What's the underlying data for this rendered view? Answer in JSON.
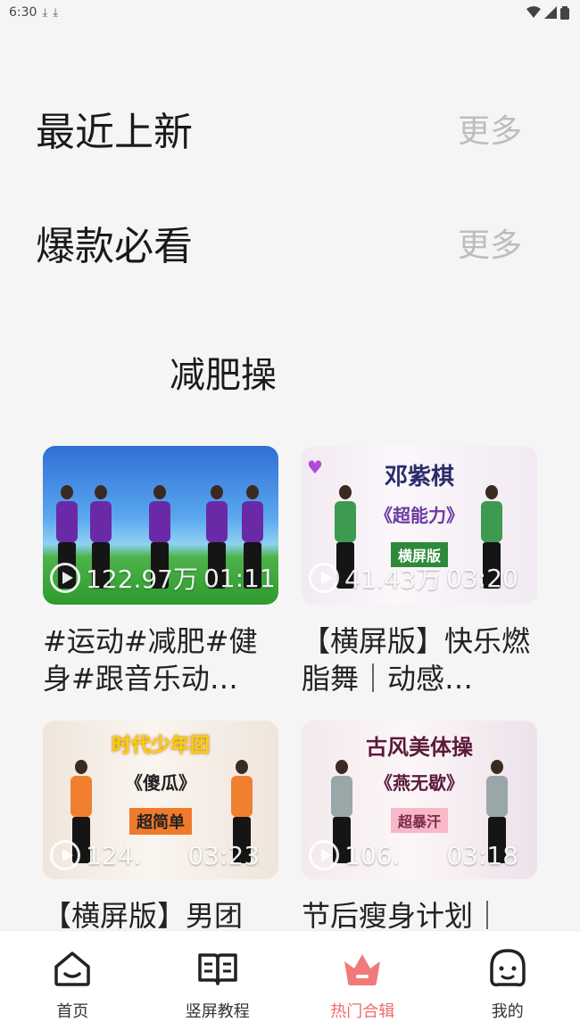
{
  "status_bar": {
    "time": "6:30"
  },
  "sections": [
    {
      "title": "最近上新",
      "more": "更多"
    },
    {
      "title": "爆款必看",
      "more": "更多"
    }
  ],
  "category": {
    "label": "减肥操"
  },
  "videos": [
    {
      "views": "122.97万",
      "duration": "01:11",
      "title": "#运动#减肥#健身#跟音乐动…",
      "banner": []
    },
    {
      "views": "41.43万",
      "duration": "03:20",
      "title": "【横屏版】快乐燃脂舞｜动感…",
      "banner": [
        "邓紫棋",
        "《超能力》",
        "横屏版"
      ]
    },
    {
      "views": "124.",
      "duration": "03:23",
      "title": "【横屏版】男团",
      "banner": [
        "时代少年团",
        "《傻瓜》",
        "超简单"
      ]
    },
    {
      "views": "106.",
      "duration": "03:18",
      "title": "节后瘦身计划｜",
      "banner": [
        "古风美体操",
        "《燕无歇》",
        "超暴汗"
      ]
    }
  ],
  "bottom_nav": [
    {
      "label": "首页",
      "icon": "home-icon"
    },
    {
      "label": "竖屏教程",
      "icon": "book-icon"
    },
    {
      "label": "热门合辑",
      "icon": "crown-icon"
    },
    {
      "label": "我的",
      "icon": "profile-icon"
    }
  ],
  "colors": {
    "accent": "#f06b6b",
    "more": "#bdbdbd",
    "background": "#f5f5f5"
  }
}
